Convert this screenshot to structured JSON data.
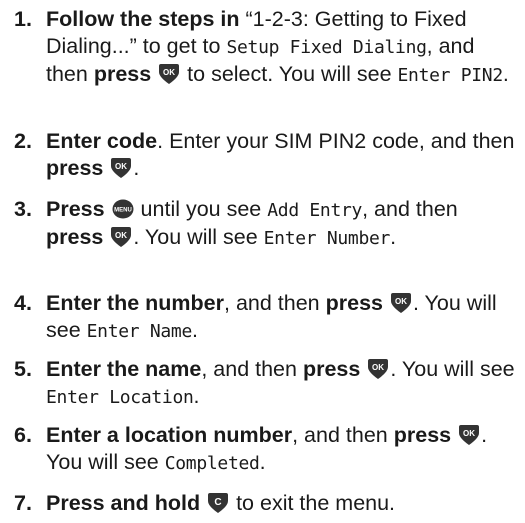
{
  "steps": [
    {
      "number": "1.",
      "bold": "Follow the steps in",
      "pre": " “1-2-3: Getting to Fixed Dialing...” to get to ",
      "mono1": "Setup Fixed Dialing",
      "mid": ", and then ",
      "bold2": "press",
      "key": "ok-key-icon",
      "post": " to select. You will see ",
      "mono2": "Enter PIN2",
      "end": "."
    },
    {
      "number": "2.",
      "bold": "Enter code",
      "pre": ". Enter your SIM PIN2 code, and then ",
      "bold2": "press",
      "key": "ok-key-icon",
      "end": "."
    },
    {
      "number": "3.",
      "bold": "Press",
      "key1": "menu-key-icon",
      "pre": " until you see ",
      "mono1": "Add Entry",
      "mid": ", and then ",
      "bold2": "press",
      "key2": "ok-key-icon",
      "post": ". You will see ",
      "mono2": "Enter Number",
      "end": "."
    },
    {
      "number": "4.",
      "bold": "Enter the number",
      "pre": ", and then ",
      "bold2": "press",
      "key": "ok-key-icon",
      "post": ". You will see ",
      "mono1": "Enter Name",
      "end": "."
    },
    {
      "number": "5.",
      "bold": "Enter the name",
      "pre": ", and then ",
      "bold2": "press",
      "key": "ok-key-icon",
      "post": ". You will see ",
      "mono1": "Enter Location",
      "end": "."
    },
    {
      "number": "6.",
      "bold": "Enter a location number",
      "pre": ", and then ",
      "bold2": "press",
      "key": "ok-key-icon",
      "post": ". You will see ",
      "mono1": "Completed",
      "end": "."
    },
    {
      "number": "7.",
      "bold": "Press and hold",
      "key": "clear-key-icon",
      "post": " to exit the menu."
    }
  ],
  "icons": {
    "ok": "OK",
    "menu": "MENU",
    "clear": "C"
  },
  "colors": {
    "key_fill": "#333333",
    "key_text": "#ffffff",
    "text": "#1a1a1a"
  }
}
